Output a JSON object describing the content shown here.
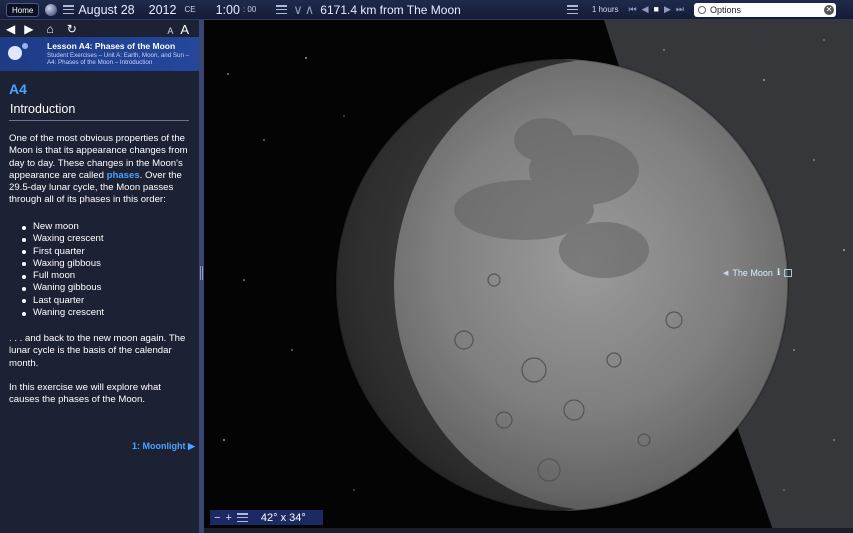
{
  "toolbar": {
    "home_label": "Home",
    "date": "August 28",
    "year": "2012",
    "era": "CE",
    "time": "1:00",
    "seconds": ": 00",
    "distance": "6171.4 km from The Moon",
    "rate": "1 hours",
    "search_placeholder": "Options"
  },
  "sidebar": {
    "font_small": "A",
    "font_large": "A",
    "lesson_title": "Lesson A4: Phases of the Moon",
    "lesson_crumb": "Student Exercises – Unit A: Earth, Moon, and Sun – A4: Phases of the Moon – Introduction",
    "section_id": "A4",
    "section_title": "Introduction",
    "p1_before": "One of the most obvious properties of the Moon is that its appearance changes from day to day. These changes in the Moon's appearance are called ",
    "p1_highlight": "phases",
    "p1_after": ". Over the 29.5-day lunar cycle, the Moon passes through all of its phases in this order:",
    "phases": [
      "New moon",
      "Waxing crescent",
      "First quarter",
      "Waxing gibbous",
      "Full moon",
      "Waning gibbous",
      "Last quarter",
      "Waning crescent"
    ],
    "p2": ". . . and back to the new moon again. The lunar cycle is the basis of the calendar month.",
    "p3": "In this exercise we will explore what causes the phases of the Moon.",
    "next_link": "1: Moonlight ▶"
  },
  "view": {
    "fov": "42° x 34°",
    "object_label": "The Moon"
  },
  "colors": {
    "accent": "#4aa2ff",
    "sidebar_bg": "#1d2134",
    "lesson_header": "#24479c"
  }
}
